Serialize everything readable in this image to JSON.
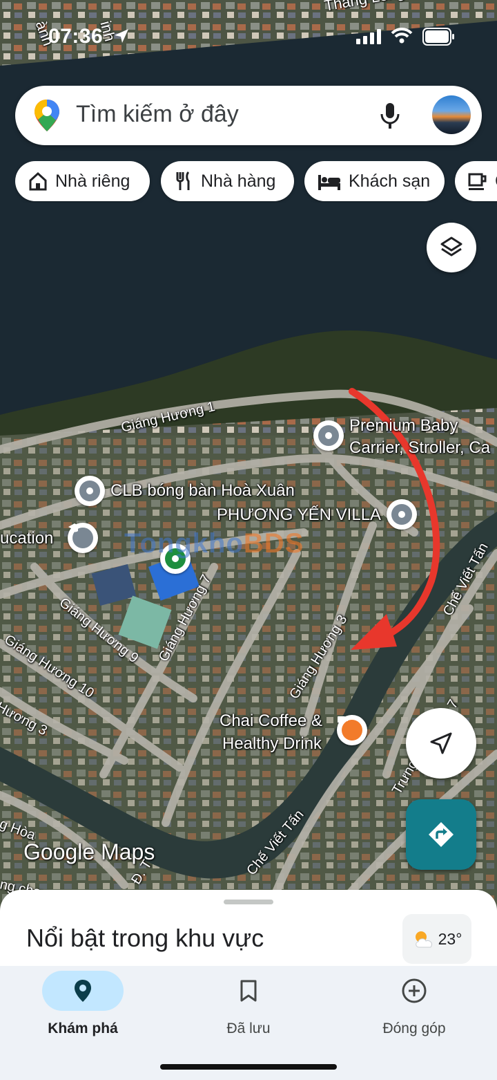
{
  "status_bar": {
    "time": "07:36"
  },
  "search": {
    "placeholder": "Tìm kiếm ở đây"
  },
  "chips": [
    {
      "label": "Nhà riêng",
      "icon": "home-icon"
    },
    {
      "label": "Nhà hàng",
      "icon": "restaurant-icon"
    },
    {
      "label": "Khách sạn",
      "icon": "hotel-icon"
    },
    {
      "label": "C",
      "icon": "coffee-icon"
    }
  ],
  "map": {
    "top_labels": [
      "Thăng Long",
      "inh",
      "ành"
    ],
    "poi_labels": {
      "premium_baby": [
        "Premium Baby",
        "Carrier, Stroller, Ca"
      ],
      "clb": "CLB bóng bàn Hoà Xuân",
      "phuong_yen": "PHƯƠNG YẾN VILLA",
      "education": "ucation",
      "chai_coffee": [
        "Chai Coffee &",
        "Healthy Drink"
      ]
    },
    "roads": {
      "giang_huong_1": "Giáng Hương 1",
      "giang_huong_7": "Giáng Hương 7",
      "giang_huong_9": "Giáng Hương 9",
      "giang_huong_10": "Giáng Hương 10",
      "giang_huong_3": "Giáng Hương 3",
      "huong_3": "Hương 3",
      "che_viet_tan_1": "Chế Viết Tấn",
      "che_viet_tan_2": "Chế Viết Tấn",
      "trung": "Trưng",
      "num_7": "7",
      "ng_hoa": "g Hòa",
      "ng_chay": "ng chạy",
      "d_t": "Đ. T"
    },
    "watermark": {
      "part1": "Tongkho",
      "part2": "BDS"
    },
    "attribution": "Google Maps"
  },
  "sheet": {
    "title": "Nổi bật trong khu vực",
    "weather": "23°"
  },
  "bottom_nav": [
    {
      "label": "Khám phá",
      "icon": "explore-pin-icon",
      "active": true
    },
    {
      "label": "Đã lưu",
      "icon": "bookmark-icon",
      "active": false
    },
    {
      "label": "Đóng góp",
      "icon": "add-circle-icon",
      "active": false
    }
  ],
  "colors": {
    "accent": "#137d8b",
    "active_pill": "#c2e7ff",
    "arrow": "#e8372c"
  }
}
